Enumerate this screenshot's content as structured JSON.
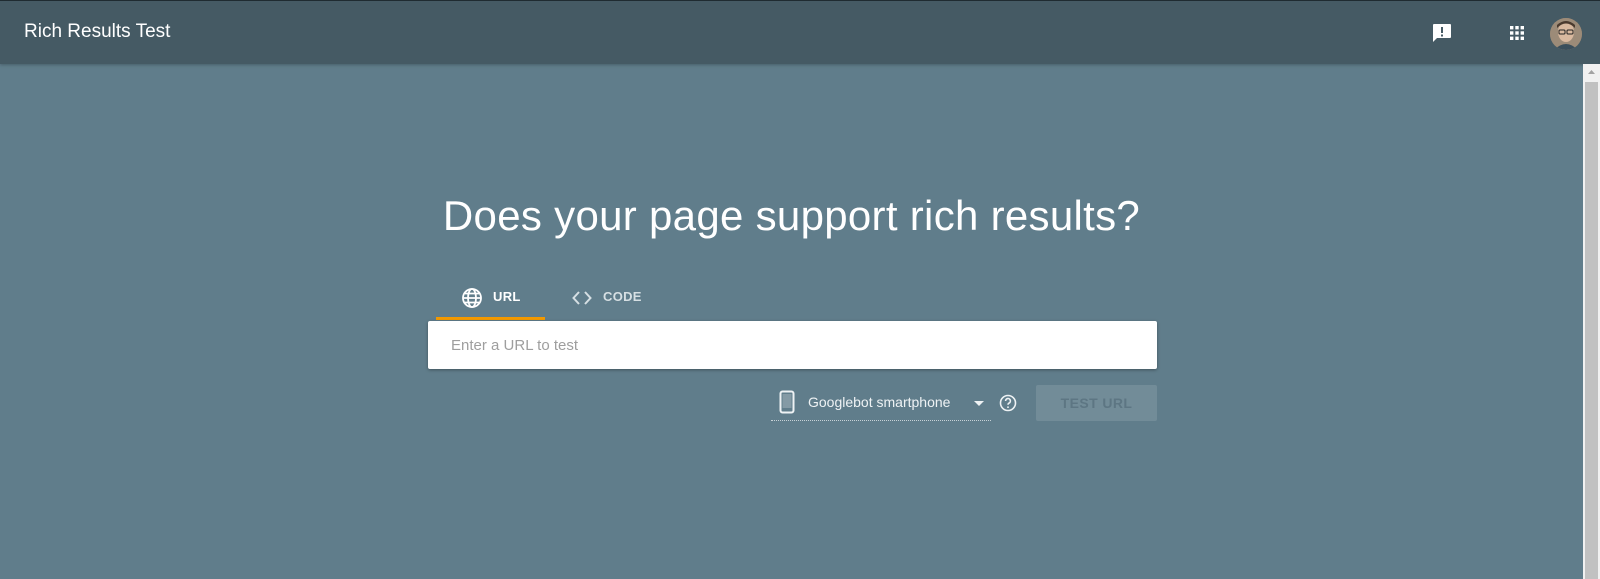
{
  "header": {
    "app_title": "Rich Results Test",
    "feedback_icon": "feedback-icon",
    "apps_icon": "apps-grid-icon",
    "avatar_icon": "user-avatar"
  },
  "main": {
    "headline": "Does your page support rich results?",
    "tabs": [
      {
        "label": "URL",
        "icon": "globe-icon",
        "selected": true
      },
      {
        "label": "CODE",
        "icon": "code-icon",
        "selected": false
      }
    ],
    "url_input": {
      "placeholder": "Enter a URL to test",
      "value": ""
    },
    "device_select": {
      "icon": "smartphone-icon",
      "selected": "Googlebot smartphone"
    },
    "help_icon": "help-circle-icon",
    "test_button": "TEST URL"
  },
  "colors": {
    "background": "#607d8b",
    "header": "#455a64",
    "tab_indicator": "#f29900"
  }
}
